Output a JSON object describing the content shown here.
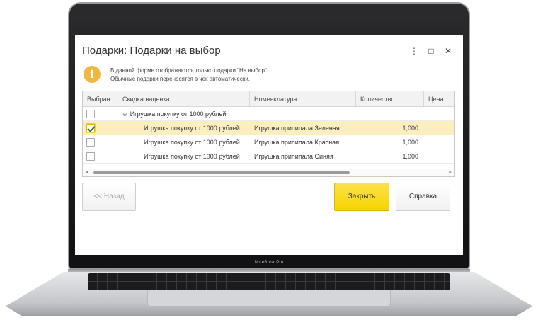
{
  "device": {
    "brand_label": "NoteBook Pro"
  },
  "dialog": {
    "title": "Подарки: Подарки на выбор",
    "controls": {
      "more": "⋮",
      "maximize": "□",
      "close": "✕"
    },
    "info": {
      "icon": "info-icon",
      "line1": "В данной форме отображаются только подарки \"На выбор\".",
      "line2": "Обычные подарки переносятся в чек автоматически."
    },
    "table": {
      "columns": [
        "Выбран",
        "Скидка наценка",
        "Номенклатура",
        "Количество",
        "Цена"
      ],
      "group_row": {
        "label": "Игрушка покупку от 1000 рублей",
        "checked": false
      },
      "rows": [
        {
          "checked": true,
          "discount": "Игрушка покупку от 1000 рублей",
          "item": "Игрушка припипала Зеленая",
          "qty": "1,000",
          "price": "",
          "selected": true
        },
        {
          "checked": false,
          "discount": "Игрушка покупку от 1000 рублей",
          "item": "Игрушка припипала Красная",
          "qty": "1,000",
          "price": "",
          "selected": false
        },
        {
          "checked": false,
          "discount": "Игрушка покупку от 1000 рублей",
          "item": "Игрушка припипала Синяя",
          "qty": "1,000",
          "price": "",
          "selected": false
        }
      ]
    },
    "buttons": {
      "back": "<< Назад",
      "close": "Закрыть",
      "help": "Справка"
    }
  },
  "colors": {
    "accent_yellow": "#f6d400",
    "selected_row": "#fbeebf",
    "info_icon": "#f1b63e"
  }
}
